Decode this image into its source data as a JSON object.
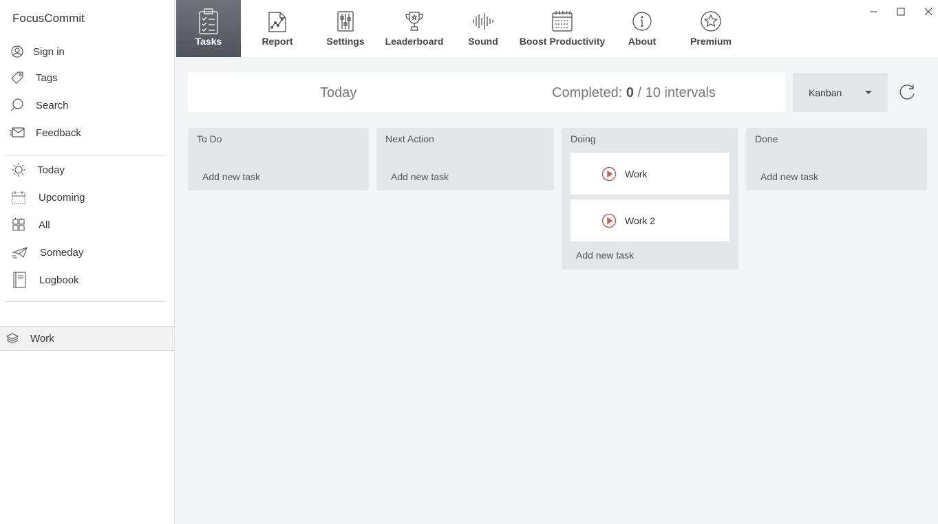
{
  "app": {
    "title": "FocusCommit"
  },
  "sidebar": {
    "account_items": [
      {
        "label": "Sign in",
        "icon": "user-icon"
      },
      {
        "label": "Tags",
        "icon": "tag-icon"
      },
      {
        "label": "Search",
        "icon": "search-icon"
      },
      {
        "label": "Feedback",
        "icon": "feedback-icon"
      }
    ],
    "view_items": [
      {
        "label": "Today",
        "icon": "sun-icon"
      },
      {
        "label": "Upcoming",
        "icon": "calendar-icon"
      },
      {
        "label": "All",
        "icon": "boxes-icon"
      },
      {
        "label": "Someday",
        "icon": "paper-plane-icon"
      },
      {
        "label": "Logbook",
        "icon": "book-icon"
      }
    ],
    "projects": [
      {
        "label": "Work",
        "icon": "layers-icon"
      }
    ]
  },
  "toolbar": {
    "tabs": [
      {
        "label": "Tasks",
        "icon": "clipboard-checklist-icon",
        "active": true
      },
      {
        "label": "Report",
        "icon": "report-chart-icon"
      },
      {
        "label": "Settings",
        "icon": "sliders-icon"
      },
      {
        "label": "Leaderboard",
        "icon": "trophy-icon"
      },
      {
        "label": "Sound",
        "icon": "soundwave-icon"
      },
      {
        "label": "Boost Productivity",
        "icon": "calendar-grid-icon"
      },
      {
        "label": "About",
        "icon": "info-icon"
      },
      {
        "label": "Premium",
        "icon": "star-icon"
      }
    ]
  },
  "summary": {
    "period": "Today",
    "completed_label": "Completed:",
    "completed_count": "0",
    "completed_total": "/ 10 intervals"
  },
  "view_select": {
    "value": "Kanban"
  },
  "kanban": {
    "add_label": "Add new task",
    "columns": [
      {
        "title": "To Do",
        "cards": []
      },
      {
        "title": "Next Action",
        "cards": []
      },
      {
        "title": "Doing",
        "cards": [
          {
            "title": "Work"
          },
          {
            "title": "Work 2"
          }
        ]
      },
      {
        "title": "Done",
        "cards": []
      }
    ]
  },
  "colors": {
    "active_tab": "#5f636a",
    "play_icon": "#b5655d",
    "column_bg": "#e4e6e9",
    "page_bg": "#f4f5f7"
  }
}
